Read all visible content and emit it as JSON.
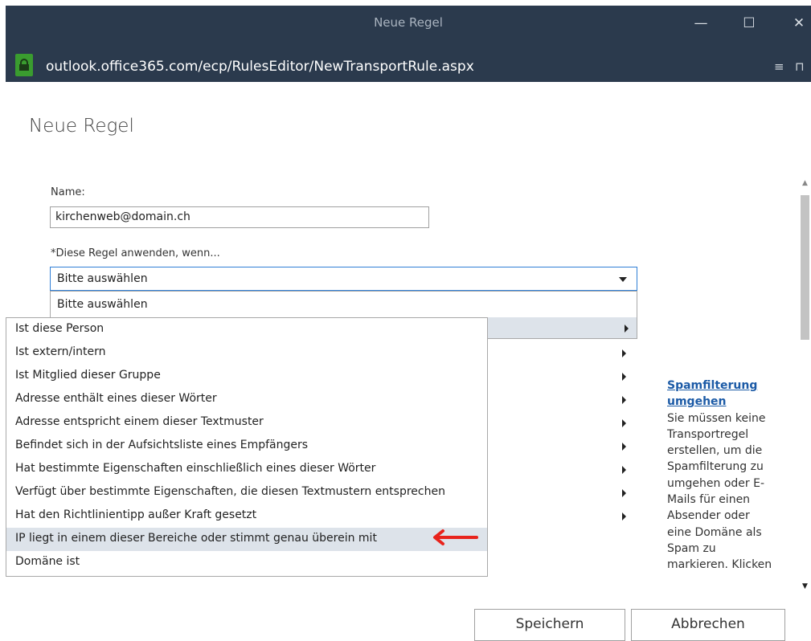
{
  "window": {
    "title": "Neue Regel",
    "url": "outlook.office365.com/ecp/RulesEditor/NewTransportRule.aspx",
    "minimize_glyph": "—",
    "maximize_glyph": "☐",
    "close_glyph": "✕",
    "reader_glyph": "≡",
    "bookmark_glyph": "⊓"
  },
  "page": {
    "title": "Neue Regel",
    "name_label": "Name:",
    "name_value": "kirchenweb@domain.ch",
    "condition_label": "*Diese Regel anwenden, wenn...",
    "condition_selected": "Bitte auswählen"
  },
  "dropdown": {
    "first_option": "Bitte auswählen"
  },
  "submenu": {
    "items": [
      "Ist diese Person",
      "Ist extern/intern",
      "Ist Mitglied dieser Gruppe",
      "Adresse enthält eines dieser Wörter",
      "Adresse entspricht einem dieser Textmuster",
      "Befindet sich in der Aufsichtsliste eines Empfängers",
      "Hat bestimmte Eigenschaften einschließlich eines dieser Wörter",
      "Verfügt über bestimmte Eigenschaften, die diesen Textmustern entsprechen",
      "Hat den Richtlinientipp außer Kraft gesetzt",
      "IP liegt in einem dieser Bereiche oder stimmt genau überein mit",
      "Domäne ist"
    ],
    "selected_index": 9
  },
  "help": {
    "link_line1": "Spamfilterung",
    "link_line2": "umgehen",
    "lines": [
      "Sie müssen keine",
      "Transportregel",
      "erstellen, um die",
      "Spamfilterung zu",
      "umgehen oder E-",
      "Mails für einen",
      "Absender oder",
      "eine Domäne als",
      "Spam zu",
      "markieren. Klicken"
    ]
  },
  "buttons": {
    "save": "Speichern",
    "cancel": "Abbrechen"
  },
  "colors": {
    "titlebar": "#2b3a4d",
    "lock": "#3a9c2f",
    "highlight": "#dde3ea",
    "link": "#1b5aa6",
    "annotation_arrow": "#e8231c"
  }
}
